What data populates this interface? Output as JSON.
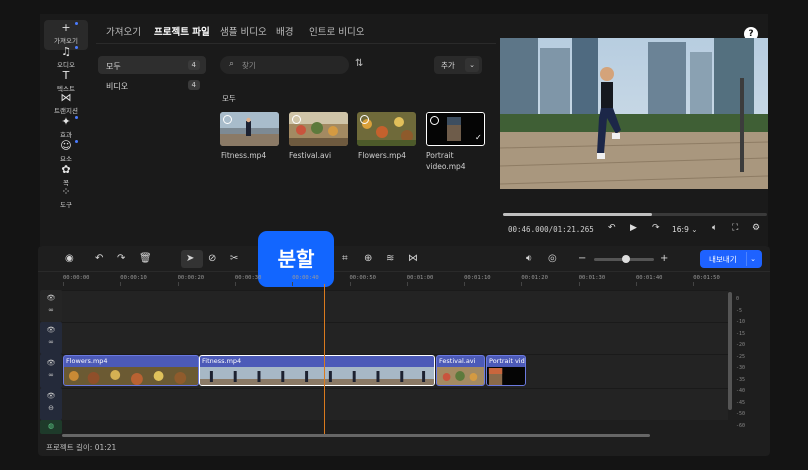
{
  "sidebar": {
    "items": [
      {
        "label": "가져오기",
        "icon": "plus-icon",
        "glyph": "+"
      },
      {
        "label": "오디오",
        "icon": "music-icon",
        "glyph": "♫"
      },
      {
        "label": "텍스트",
        "icon": "text-icon",
        "glyph": "T"
      },
      {
        "label": "트랜지션",
        "icon": "transition-icon",
        "glyph": "⋈"
      },
      {
        "label": "효과",
        "icon": "effects-icon",
        "glyph": "✦"
      },
      {
        "label": "요소",
        "icon": "elements-icon",
        "glyph": "☺"
      },
      {
        "label": "꾝",
        "icon": "sticker-icon",
        "glyph": "✿"
      },
      {
        "label": "도구",
        "icon": "tools-icon",
        "glyph": "⁘"
      }
    ]
  },
  "tabs": [
    "가져오기",
    "프로젝트 파일",
    "샘플 비디오",
    "배경",
    "인트로 비디오"
  ],
  "categories": [
    {
      "label": "모두",
      "count": "4"
    },
    {
      "label": "비디오",
      "count": "4"
    }
  ],
  "search": {
    "placeholder": "찾기"
  },
  "add_button": {
    "label": "추가"
  },
  "section_label": "모두",
  "media": [
    {
      "name": "Fitness.mp4"
    },
    {
      "name": "Festival.avi"
    },
    {
      "name": "Flowers.mp4"
    },
    {
      "name": "Portrait\nvideo.mp4"
    }
  ],
  "player": {
    "current_time": "00:46.000",
    "total_time": "01:21.265",
    "timecode": "00:46.000/01:21.265",
    "progress": 0.566,
    "aspect_ratio": "16:9"
  },
  "toolbar": {
    "tooltip": "분할",
    "export_label": "내보내기"
  },
  "ruler_ticks": [
    "00:00:00",
    "00:00:10",
    "00:00:20",
    "00:00:30",
    "00:00:40",
    "00:00:50",
    "00:01:00",
    "00:01:10",
    "00:01:20",
    "00:01:30",
    "00:01:40",
    "00:01:50"
  ],
  "clips": [
    {
      "name": "Flowers.mp4"
    },
    {
      "name": "Fitness.mp4"
    },
    {
      "name": "Festival.avi"
    },
    {
      "name": "Portrait vide"
    }
  ],
  "meter_labels": [
    "0",
    "-5",
    "-10",
    "-15",
    "-20",
    "-25",
    "-30",
    "-35",
    "-40",
    "-45",
    "-50",
    "-60"
  ],
  "footer": {
    "project_length": "프로젝트 길이: 01:21"
  },
  "colors": {
    "accent": "#1266ff",
    "playhead": "#d97a1e",
    "clip": "#4c5ab8"
  }
}
